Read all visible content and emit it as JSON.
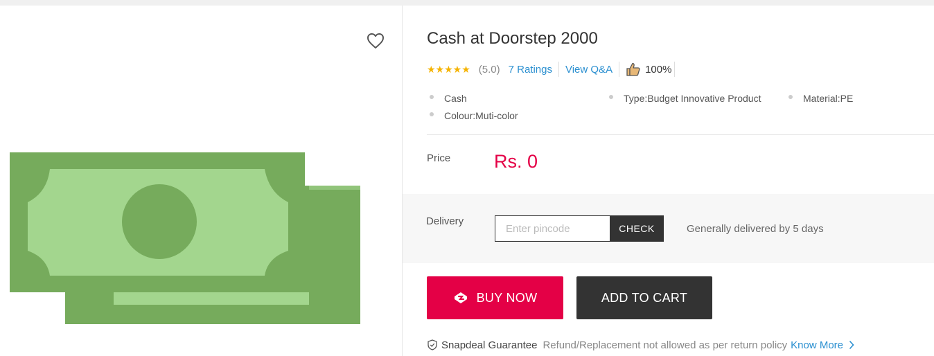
{
  "product": {
    "title": "Cash at Doorstep 2000",
    "stars": "★★★★★",
    "rating_value": "(5.0)",
    "ratings_link": "7 Ratings",
    "qa_link": "View Q&A",
    "recommend_pct": "100%"
  },
  "features": [
    "Cash",
    "Type:Budget Innovative Product",
    "Material:PE",
    "Colour:Muti-color"
  ],
  "price": {
    "label": "Price",
    "value": "Rs. 0"
  },
  "delivery": {
    "label": "Delivery",
    "placeholder": "Enter pincode",
    "check_label": "CHECK",
    "message": "Generally delivered by 5 days"
  },
  "actions": {
    "buy_now": "BUY NOW",
    "add_to_cart": "ADD TO CART"
  },
  "guarantee": {
    "title": "Snapdeal Guarantee",
    "text": "Refund/Replacement not allowed as per return policy",
    "link": "Know More"
  },
  "icons": {
    "wishlist": "heart-outline-icon",
    "thumbs_up": "thumbs-up-icon",
    "buy": "snapdeal-logo-icon",
    "guarantee": "shield-check-icon",
    "know_more": "chevron-right-icon"
  },
  "colors": {
    "accent": "#e40046",
    "link": "#2a8fd0",
    "dark_button": "#333333",
    "star": "#f5b301",
    "cash_dark": "#76ab5c",
    "cash_light": "#a3d68e"
  }
}
